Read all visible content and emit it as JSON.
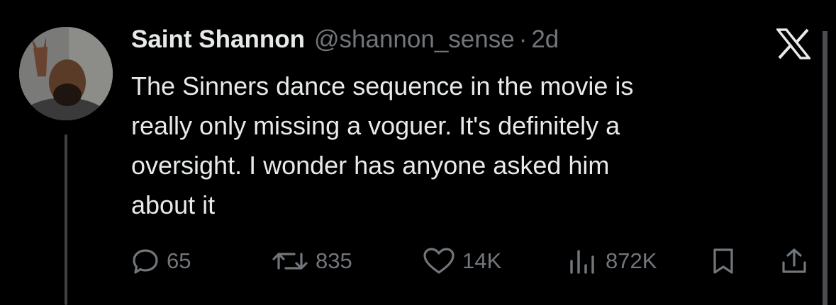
{
  "tweet": {
    "author_name": "Saint Shannon",
    "handle": "@shannon_sense",
    "separator": "·",
    "time": "2d",
    "text": "The Sinners dance sequence in the movie is\nreally only missing a voguer. It's definitely a\noversight. I wonder has anyone asked him\nabout it"
  },
  "avatar": {
    "icon": "user-avatar-photo"
  },
  "platform_logo": {
    "icon": "x-logo-icon"
  },
  "actions": {
    "replies": "65",
    "retweets": "835",
    "likes": "14K",
    "views": "872K",
    "bookmark_icon": "bookmark-icon",
    "share_icon": "share-icon"
  },
  "colors": {
    "background": "#000000",
    "text_primary": "#e7e9ea",
    "text_secondary": "#71767b",
    "thread_line": "#3e4144"
  }
}
